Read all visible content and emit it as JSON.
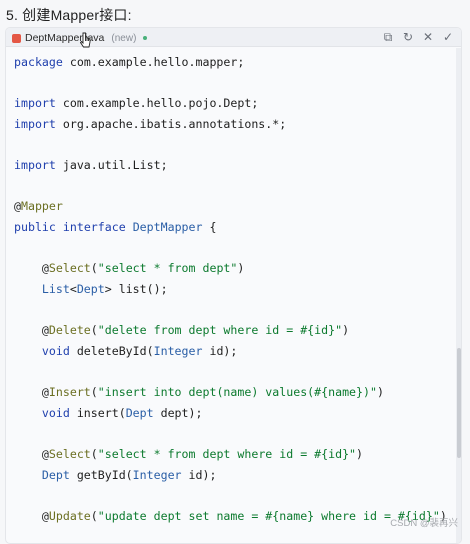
{
  "heading": "5. 创建Mapper接口:",
  "tab": {
    "filename": "DeptMapper.java",
    "status": "(new)",
    "actions": [
      "copy-icon",
      "refresh-icon",
      "close-icon",
      "check-icon"
    ]
  },
  "code": {
    "lines": [
      [
        {
          "t": "package",
          "c": "kw"
        },
        {
          "t": " com.example.hello.mapper;"
        }
      ],
      [],
      [
        {
          "t": "import",
          "c": "kw"
        },
        {
          "t": " com.example.hello.pojo.Dept;"
        }
      ],
      [
        {
          "t": "import",
          "c": "kw"
        },
        {
          "t": " org.apache.ibatis.annotations.*;"
        }
      ],
      [],
      [
        {
          "t": "import",
          "c": "kw"
        },
        {
          "t": " java.util.List;"
        }
      ],
      [],
      [
        {
          "t": "@"
        },
        {
          "t": "Mapper",
          "c": "ann"
        }
      ],
      [
        {
          "t": "public",
          "c": "kw"
        },
        {
          "t": " "
        },
        {
          "t": "interface",
          "c": "kw"
        },
        {
          "t": " "
        },
        {
          "t": "DeptMapper",
          "c": "ty"
        },
        {
          "t": " {"
        }
      ],
      [],
      [
        {
          "t": "    @"
        },
        {
          "t": "Select",
          "c": "ann"
        },
        {
          "t": "("
        },
        {
          "t": "\"select * from dept\"",
          "c": "str"
        },
        {
          "t": ")"
        }
      ],
      [
        {
          "t": "    "
        },
        {
          "t": "List",
          "c": "ty"
        },
        {
          "t": "<"
        },
        {
          "t": "Dept",
          "c": "ty"
        },
        {
          "t": "> list();"
        }
      ],
      [],
      [
        {
          "t": "    @"
        },
        {
          "t": "Delete",
          "c": "ann"
        },
        {
          "t": "("
        },
        {
          "t": "\"delete from dept where id = #{id}\"",
          "c": "str"
        },
        {
          "t": ")"
        }
      ],
      [
        {
          "t": "    "
        },
        {
          "t": "void",
          "c": "kw"
        },
        {
          "t": " deleteById("
        },
        {
          "t": "Integer",
          "c": "ty"
        },
        {
          "t": " id);"
        }
      ],
      [],
      [
        {
          "t": "    @"
        },
        {
          "t": "Insert",
          "c": "ann"
        },
        {
          "t": "("
        },
        {
          "t": "\"insert into dept(name) values(#{name})\"",
          "c": "str"
        },
        {
          "t": ")"
        }
      ],
      [
        {
          "t": "    "
        },
        {
          "t": "void",
          "c": "kw"
        },
        {
          "t": " insert("
        },
        {
          "t": "Dept",
          "c": "ty"
        },
        {
          "t": " dept);"
        }
      ],
      [],
      [
        {
          "t": "    @"
        },
        {
          "t": "Select",
          "c": "ann"
        },
        {
          "t": "("
        },
        {
          "t": "\"select * from dept where id = #{id}\"",
          "c": "str"
        },
        {
          "t": ")"
        }
      ],
      [
        {
          "t": "    "
        },
        {
          "t": "Dept",
          "c": "ty"
        },
        {
          "t": " getById("
        },
        {
          "t": "Integer",
          "c": "ty"
        },
        {
          "t": " id);"
        }
      ],
      [],
      [
        {
          "t": "    @"
        },
        {
          "t": "Update",
          "c": "ann"
        },
        {
          "t": "("
        },
        {
          "t": "\"update dept set name = #{name} where id = #{id}\"",
          "c": "str"
        },
        {
          "t": ")"
        }
      ]
    ]
  },
  "watermark": "CSDN @裴再兴"
}
